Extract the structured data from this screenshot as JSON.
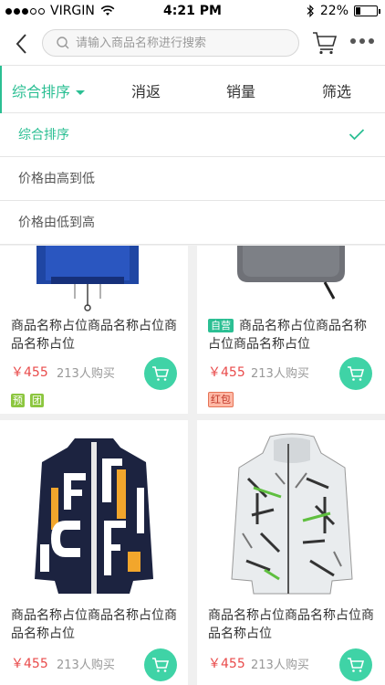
{
  "status_bar": {
    "carrier": "VIRGIN",
    "time": "4:21 PM",
    "battery": "22%"
  },
  "nav": {
    "search_placeholder": "请输入商品名称进行搜索",
    "icons": [
      "back-chevron-icon",
      "search-icon",
      "cart-icon",
      "more-icon"
    ]
  },
  "sort_tabs": [
    {
      "label": "综合排序",
      "active": true
    },
    {
      "label": "消返",
      "active": false
    },
    {
      "label": "销量",
      "active": false
    },
    {
      "label": "筛选",
      "active": false
    }
  ],
  "sort_options": [
    {
      "label": "综合排序",
      "selected": true
    },
    {
      "label": "价格由高到低",
      "selected": false
    },
    {
      "label": "价格由低到高",
      "selected": false
    }
  ],
  "products": [
    {
      "title": "商品名称占位商品名称占位商品名称占位",
      "self_run": "",
      "price": "￥455",
      "sold": "213人购买",
      "tags": [
        "预",
        "团"
      ]
    },
    {
      "title": "商品名称占位商品名称占位商品名称占位",
      "self_run": "自营",
      "price": "￥455",
      "sold": "213人购买",
      "tags": [
        "红包"
      ]
    },
    {
      "title": "商品名称占位商品名称占位商品名称占位",
      "self_run": "",
      "price": "￥455",
      "sold": "213人购买",
      "tags": []
    },
    {
      "title": "商品名称占位商品名称占位商品名称占位",
      "self_run": "",
      "price": "￥455",
      "sold": "213人购买",
      "tags": []
    }
  ],
  "colors": {
    "accent": "#2bbf93",
    "price": "#e94b4b",
    "cart_button": "#3fd3a6"
  }
}
